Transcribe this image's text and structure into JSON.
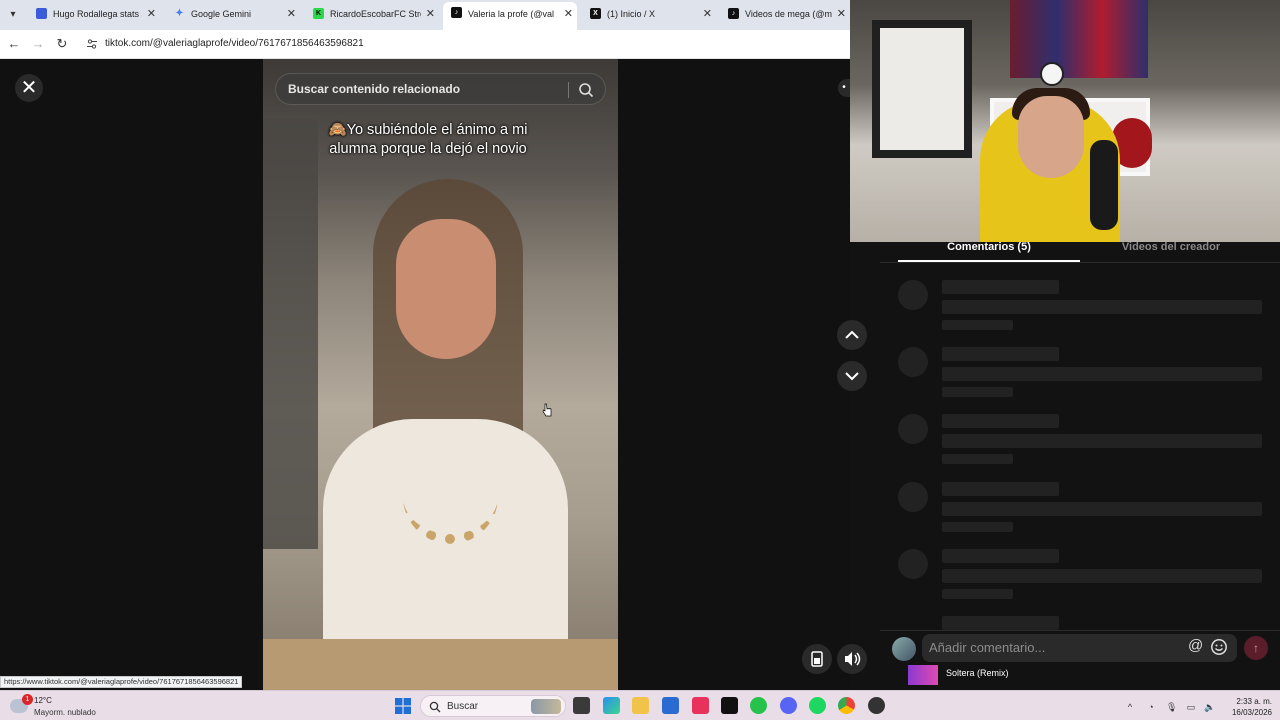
{
  "browser": {
    "tabs": [
      {
        "label": "Hugo Rodallega stats and",
        "favicon": "stats-icon",
        "color": "#3b5bdb",
        "active": false
      },
      {
        "label": "Google Gemini",
        "favicon": "gemini-icon",
        "color": "#4a7ef0",
        "active": false
      },
      {
        "label": "RicardoEscobarFC Stream",
        "favicon": "kick-icon",
        "color": "#2bd84a",
        "active": false
      },
      {
        "label": "Valeria la profe (@val",
        "favicon": "tiktok-icon",
        "color": "#111111",
        "active": true
      },
      {
        "label": "(1) Inicio / X",
        "favicon": "x-icon",
        "color": "#111111",
        "active": false
      },
      {
        "label": "Videos de mega (@mega",
        "favicon": "tiktok-icon",
        "color": "#111111",
        "active": false
      }
    ],
    "url": "tiktok.com/@valeriaglaprofe/video/7617671856463596821",
    "status_url": "https://www.tiktok.com/@valeriaglaprofe/video/7617671856463596821"
  },
  "video": {
    "search_placeholder": "Buscar contenido relacionado",
    "caption": "Yo subiéndole el ánimo a mi alumna porque la dejó el novio",
    "caption_emoji": "🙈"
  },
  "panel": {
    "tab_comments": "Comentarios (5)",
    "tab_creator": "Videos del creador",
    "comment_placeholder": "Añadir comentario...",
    "at_symbol": "@",
    "music_title": "Soltera (Remix)"
  },
  "taskbar": {
    "weather_temp": "12°C",
    "weather_condition": "Mayorm. nublado",
    "weather_badge": "1",
    "search_label": "Buscar",
    "time": "2:33 a. m.",
    "date": "16/03/2026",
    "apps": [
      "file-explorer-icon",
      "edge-icon",
      "folder-icon",
      "store-icon",
      "tiktok-icon",
      "tiktok-icon",
      "whatsapp-icon",
      "discord-icon",
      "spotify-icon",
      "chrome-icon",
      "app-icon"
    ]
  }
}
